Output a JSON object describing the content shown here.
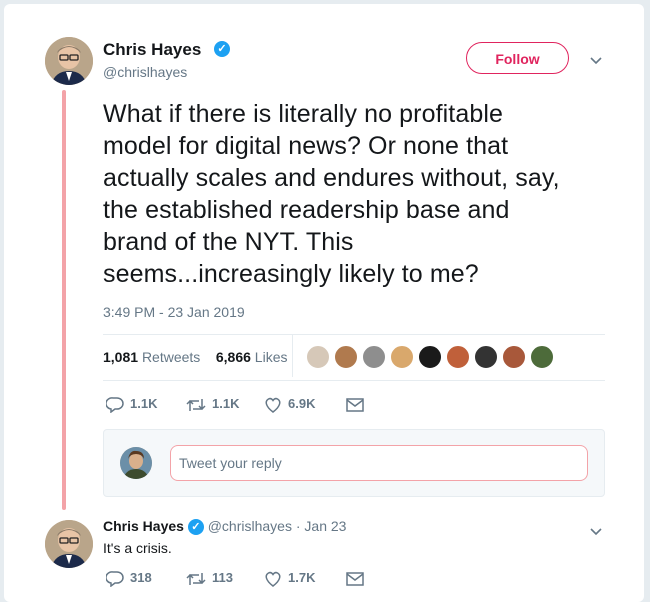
{
  "tweet": {
    "author_name": "Chris Hayes",
    "handle": "@chrislhayes",
    "follow_label": "Follow",
    "text": "What if there is literally no profitable model for digital news? Or none that actually scales and endures without, say, the established readership base and brand of the NYT. This seems...increasingly likely to me?",
    "timestamp": "3:49 PM - 23 Jan 2019",
    "retweets_count": "1,081",
    "retweets_label": "Retweets",
    "likes_count": "6,866",
    "likes_label": "Likes",
    "actions": {
      "replies": "1.1K",
      "retweets": "1.1K",
      "likes": "6.9K"
    }
  },
  "reply_composer": {
    "placeholder": "Tweet your reply"
  },
  "reply": {
    "author_name": "Chris Hayes",
    "handle": "@chrislhayes",
    "date": "· Jan 23",
    "text": "It's a crisis.",
    "actions": {
      "replies": "318",
      "retweets": "113",
      "likes": "1.7K"
    }
  },
  "colors": {
    "accent": "#e0245e",
    "thread_line": "#f3a3a8",
    "verified": "#1da1f2",
    "secondary_text": "#657786"
  },
  "likers": [
    "liker-1",
    "liker-2",
    "liker-3",
    "liker-4",
    "liker-5",
    "liker-6",
    "liker-7",
    "liker-8",
    "liker-9",
    "liker-10"
  ]
}
